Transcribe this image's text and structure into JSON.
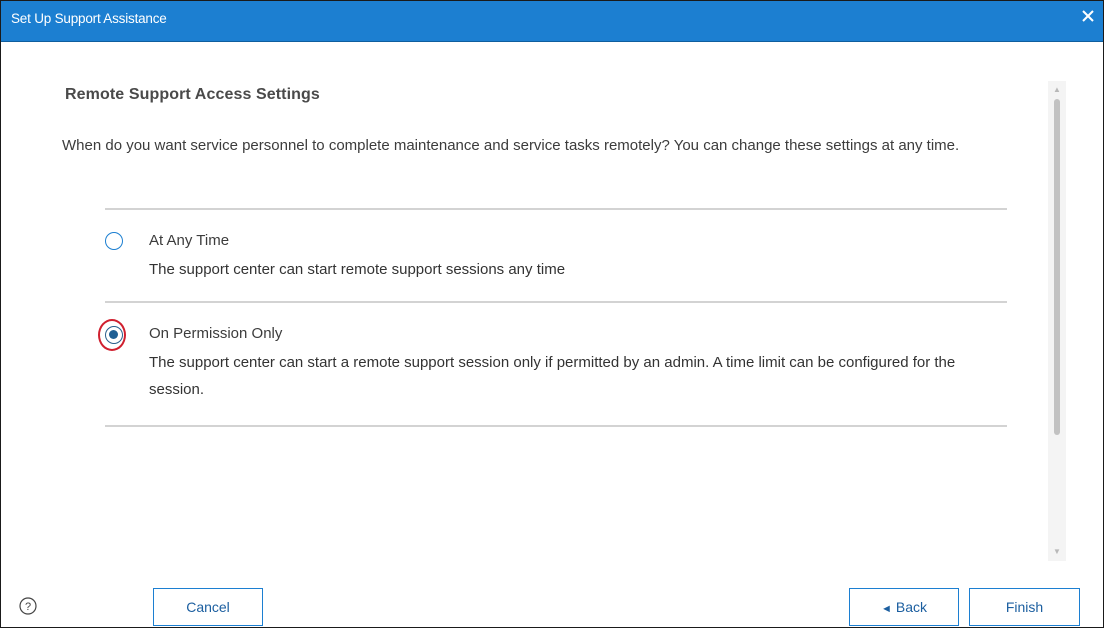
{
  "dialog": {
    "title": "Set Up Support Assistance",
    "close_glyph": "✕"
  },
  "section": {
    "title": "Remote Support Access Settings",
    "intro": "When do you want service personnel to complete maintenance and service tasks remotely? You can change these settings at any time."
  },
  "options": [
    {
      "label": "At Any Time",
      "description": "The support center can start remote support sessions any time",
      "selected": false
    },
    {
      "label": "On Permission Only",
      "description": "The support center can start a remote support session only if permitted by an admin. A time limit can be configured for the session.",
      "selected": true
    }
  ],
  "scrollbar": {
    "up_glyph": "▲",
    "down_glyph": "▼"
  },
  "footer": {
    "help_glyph": "?",
    "cancel_label": "Cancel",
    "back_arrow": "◄",
    "back_label": "Back",
    "finish_label": "Finish"
  },
  "colors": {
    "titlebar": "#1c7fd1",
    "accent": "#1c7fd1",
    "focus_ring": "#d0202f"
  }
}
